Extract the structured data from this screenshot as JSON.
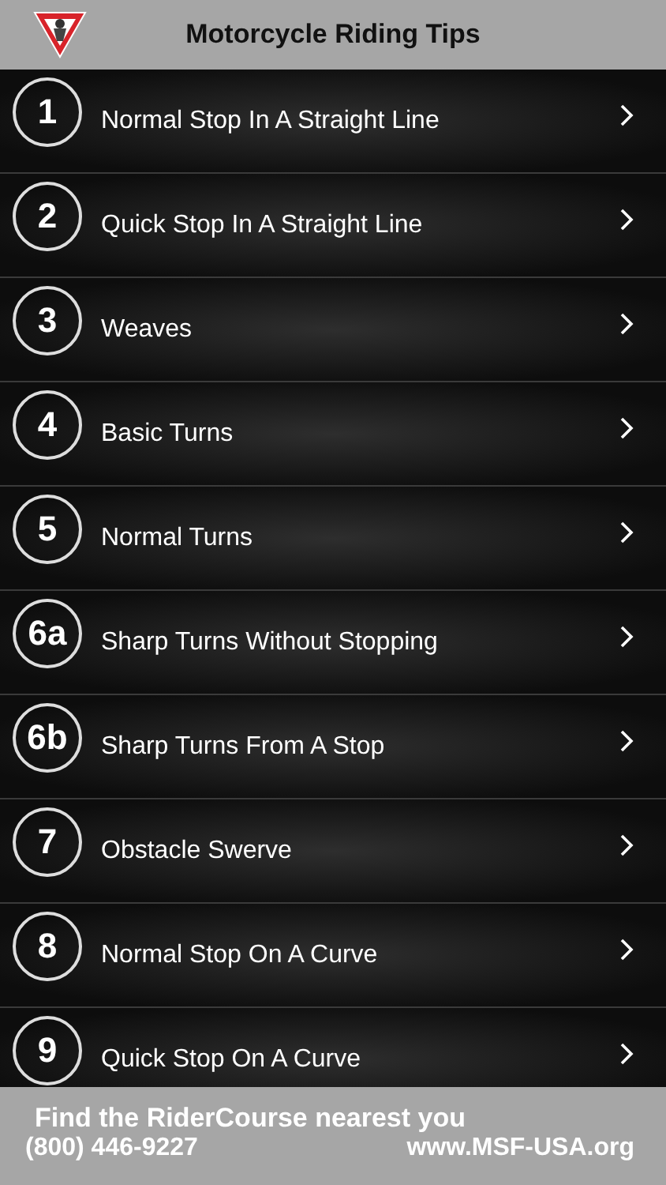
{
  "header": {
    "title": "Motorcycle Riding Tips"
  },
  "tips": [
    {
      "number": "1",
      "title": "Normal Stop In A Straight Line"
    },
    {
      "number": "2",
      "title": "Quick Stop In A Straight Line"
    },
    {
      "number": "3",
      "title": "Weaves"
    },
    {
      "number": "4",
      "title": "Basic Turns"
    },
    {
      "number": "5",
      "title": "Normal Turns"
    },
    {
      "number": "6a",
      "title": "Sharp Turns Without Stopping"
    },
    {
      "number": "6b",
      "title": "Sharp Turns From A Stop"
    },
    {
      "number": "7",
      "title": "Obstacle Swerve"
    },
    {
      "number": "8",
      "title": "Normal Stop On A Curve"
    },
    {
      "number": "9",
      "title": "Quick Stop On A Curve"
    }
  ],
  "footer": {
    "heading": "Find the RiderCourse nearest you",
    "phone": "(800) 446-9227",
    "website": "www.MSF-USA.org"
  }
}
